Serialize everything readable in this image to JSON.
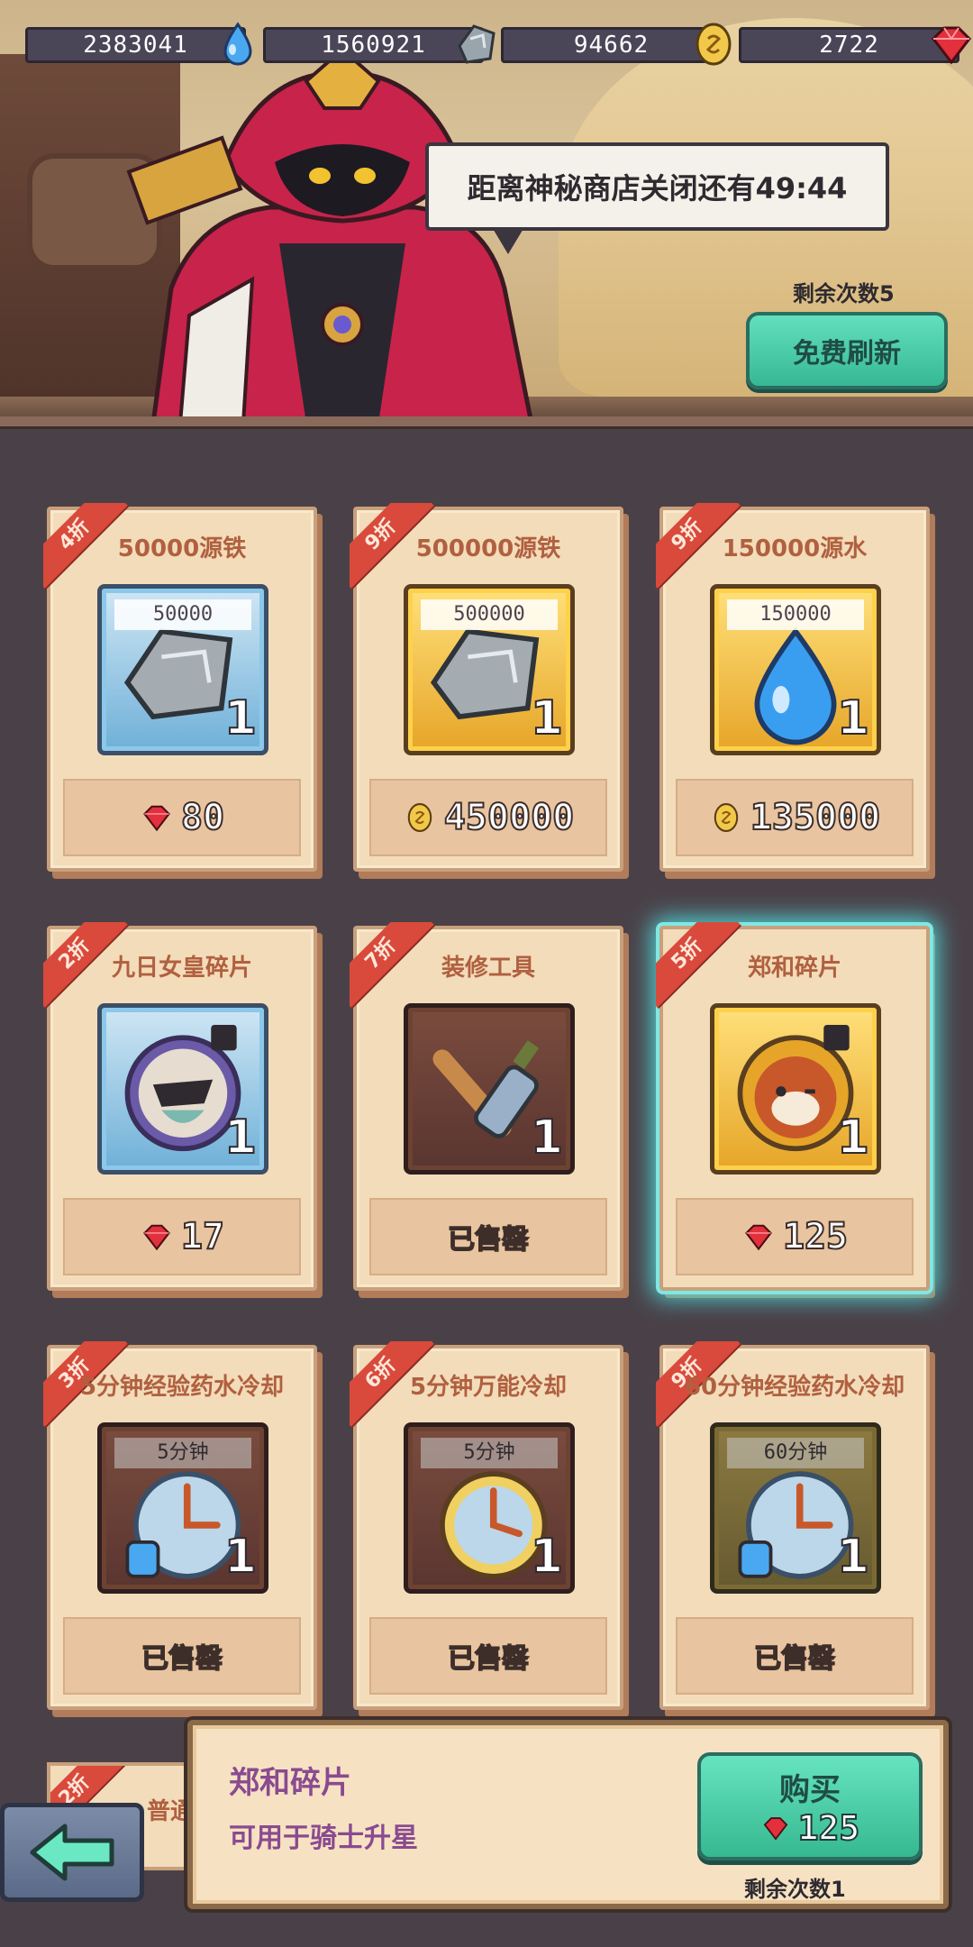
{
  "currencies": [
    {
      "value": "2383041",
      "icon": "water-drop-icon"
    },
    {
      "value": "1560921",
      "icon": "iron-ore-icon"
    },
    {
      "value": "94662",
      "icon": "gold-coin-icon"
    },
    {
      "value": "2722",
      "icon": "red-gem-icon"
    }
  ],
  "shop": {
    "timer_text": "距离神秘商店关闭还有49:44",
    "refresh_remaining": "剩余次数5",
    "refresh_button": "免费刷新"
  },
  "items": [
    {
      "discount": "4折",
      "title": "50000源铁",
      "label": "50000",
      "qty": "1",
      "price": "80",
      "currency": "gem",
      "style": "blue",
      "art": "ore"
    },
    {
      "discount": "9折",
      "title": "500000源铁",
      "label": "500000",
      "qty": "1",
      "price": "450000",
      "currency": "coin",
      "style": "gold",
      "art": "ore"
    },
    {
      "discount": "9折",
      "title": "150000源水",
      "label": "150000",
      "qty": "1",
      "price": "135000",
      "currency": "coin",
      "style": "gold",
      "art": "drop"
    },
    {
      "discount": "2折",
      "title": "九日女皇碎片",
      "label": "",
      "qty": "1",
      "price": "17",
      "currency": "gem",
      "style": "blue",
      "art": "hero"
    },
    {
      "discount": "7折",
      "title": "装修工具",
      "label": "",
      "qty": "1",
      "price": "已售罄",
      "currency": "none",
      "style": "brown",
      "art": "tools"
    },
    {
      "discount": "5折",
      "title": "郑和碎片",
      "label": "",
      "qty": "1",
      "price": "125",
      "currency": "gem",
      "style": "gold",
      "art": "panda"
    },
    {
      "discount": "3折",
      "title": "5分钟经验药水冷却",
      "label": "5分钟",
      "qty": "1",
      "price": "已售罄",
      "currency": "none",
      "style": "brown",
      "art": "clock"
    },
    {
      "discount": "6折",
      "title": "5分钟万能冷却",
      "label": "5分钟",
      "qty": "1",
      "price": "已售罄",
      "currency": "none",
      "style": "brown",
      "art": "clock-gold"
    },
    {
      "discount": "9折",
      "title": "60分钟经验药水冷却",
      "label": "60分钟",
      "qty": "1",
      "price": "已售罄",
      "currency": "none",
      "style": "olive",
      "art": "clock"
    }
  ],
  "partial_item": {
    "discount": "2折",
    "title": "普通头"
  },
  "detail": {
    "name": "郑和碎片",
    "description": "可用于骑士升星",
    "buy_label": "购买",
    "buy_price": "125",
    "buy_remaining": "剩余次数1"
  },
  "colors": {
    "accent": "#45c9a4",
    "ribbon": "#d94a3c",
    "selected_glow": "#4fd6d8"
  }
}
